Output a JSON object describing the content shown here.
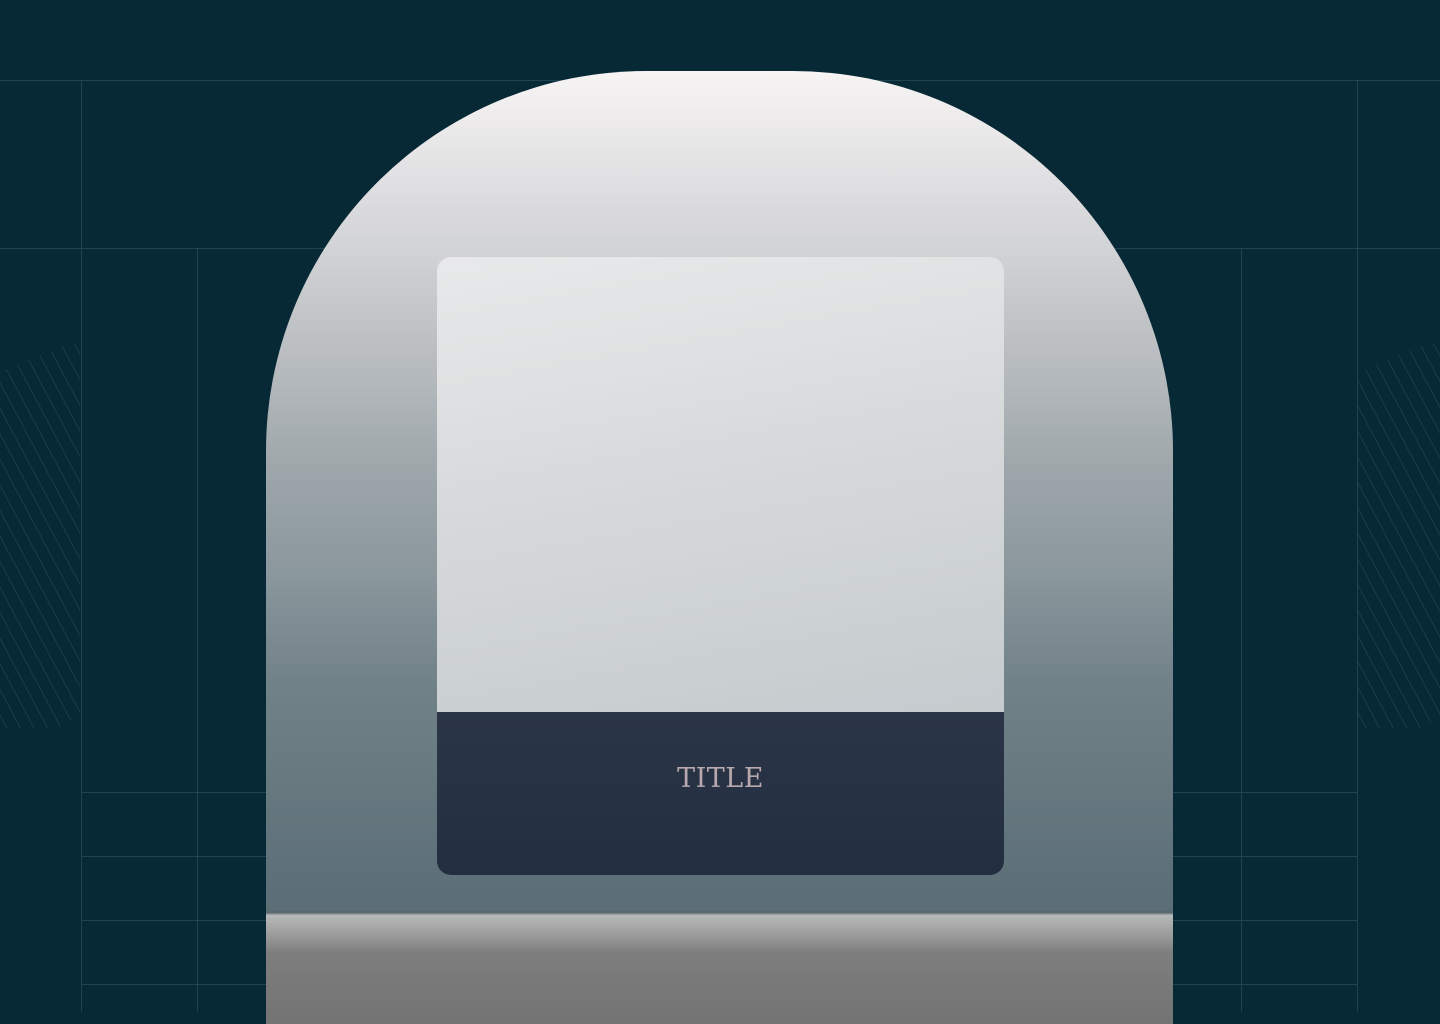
{
  "card": {
    "title": "TITLE"
  },
  "colors": {
    "background": "#072835",
    "card_footer": "#28334a",
    "title_text": "#b9a9ae",
    "grid_lines": "#1e4452"
  }
}
